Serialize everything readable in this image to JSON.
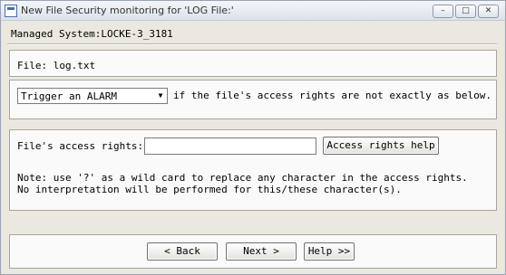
{
  "window": {
    "title": "New File Security monitoring for 'LOG File:'",
    "controls": {
      "minimize": "–",
      "maximize": "□",
      "close": "✕"
    }
  },
  "header": {
    "managed_system": "Managed System:LOCKE-3_3181"
  },
  "file": {
    "label": "File: log.txt"
  },
  "trigger": {
    "selected": "Trigger an ALARM",
    "condition_text": "if the file's access rights are not exactly as below."
  },
  "rights": {
    "label": "File's access rights:",
    "value": "",
    "help_button": "Access rights help",
    "note_line1": "Note: use '?' as a wild card to replace any character in the access rights.",
    "note_line2": "No interpretation will be performed for this/these character(s)."
  },
  "footer": {
    "back": "< Back",
    "next": "Next >",
    "help": "Help >>"
  }
}
